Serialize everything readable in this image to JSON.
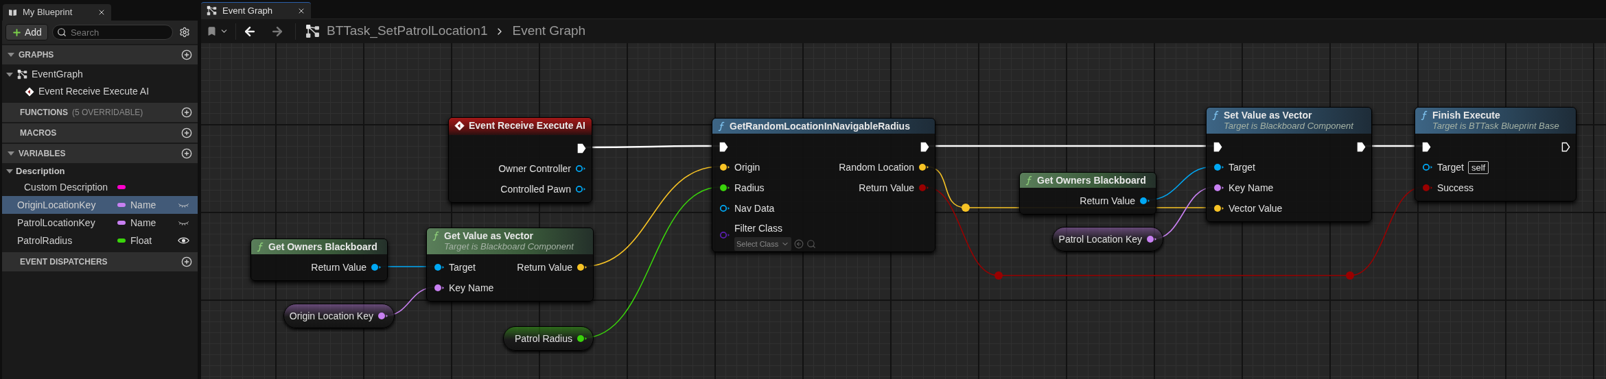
{
  "left_panel": {
    "tab": {
      "title": "My Blueprint"
    },
    "add_button": "Add",
    "search": {
      "placeholder": "Search"
    },
    "sections": [
      {
        "title": "GRAPHS",
        "expanded": true,
        "items": [
          {
            "label": "EventGraph",
            "kind": "graph",
            "expanded": true,
            "children": [
              {
                "label": "Event Receive Execute AI",
                "kind": "event"
              }
            ]
          }
        ]
      },
      {
        "title": "FUNCTIONS",
        "note": "(5 OVERRIDABLE)",
        "expanded": false
      },
      {
        "title": "MACROS",
        "expanded": false
      },
      {
        "title": "VARIABLES",
        "expanded": true,
        "variables": [
          {
            "kind": "category",
            "label": "Description",
            "expanded": true,
            "children": [
              {
                "kind": "variable",
                "name": "Custom Description",
                "color": "#ff00cc",
                "selected": false
              }
            ]
          },
          {
            "kind": "variable",
            "name": "OriginLocationKey",
            "type": "Name",
            "color": "#c880f2",
            "selected": true,
            "public": false
          },
          {
            "kind": "variable",
            "name": "PatrolLocationKey",
            "type": "Name",
            "color": "#c880f2",
            "selected": false,
            "public": false
          },
          {
            "kind": "variable",
            "name": "PatrolRadius",
            "type": "Float",
            "color": "#3ad40b",
            "selected": false,
            "public": true
          }
        ]
      },
      {
        "title": "EVENT DISPATCHERS",
        "expanded": false
      }
    ]
  },
  "graph_tab": {
    "title": "Event Graph",
    "selected": true
  },
  "breadcrumb": [
    "BTTask_SetPatrolLocation1",
    "Event Graph"
  ],
  "nodes": [
    {
      "kind": "event",
      "title": "Event Receive Execute AI",
      "outputs": [
        {
          "kind": "exec",
          "connected": true
        },
        {
          "kind": "data",
          "label": "Owner Controller",
          "color": "#00a8f4",
          "connected": false
        },
        {
          "kind": "data",
          "label": "Controlled Pawn",
          "color": "#00a8f4",
          "connected": false
        }
      ]
    },
    {
      "kind": "pure",
      "title": "Get Owners Blackboard",
      "outputs": [
        {
          "kind": "data",
          "label": "Return Value",
          "color": "#00a8f4",
          "connected": true
        }
      ]
    },
    {
      "kind": "pure",
      "title": "Get Value as Vector",
      "subtitle": "Target is Blackboard Component",
      "inputs": [
        {
          "kind": "data",
          "label": "Target",
          "color": "#00a8f4",
          "connected": true
        },
        {
          "kind": "data",
          "label": "Key Name",
          "color": "#c880f2",
          "connected": true
        }
      ],
      "outputs": [
        {
          "kind": "data",
          "label": "Return Value",
          "color": "#f7c325",
          "connected": true
        }
      ]
    },
    {
      "kind": "variable",
      "outputs": [
        {
          "kind": "data",
          "label": "Origin Location Key",
          "color": "#c880f2",
          "connected": true
        }
      ]
    },
    {
      "kind": "variable",
      "outputs": [
        {
          "kind": "data",
          "label": "Patrol Radius",
          "color": "#3ad40b",
          "connected": true
        }
      ]
    },
    {
      "kind": "function",
      "title": "GetRandomLocationInNavigableRadius",
      "inputs": [
        {
          "kind": "exec",
          "connected": true
        },
        {
          "kind": "data",
          "label": "Origin",
          "color": "#f7c325",
          "connected": true
        },
        {
          "kind": "data",
          "label": "Radius",
          "color": "#3ad40b",
          "connected": true
        },
        {
          "kind": "data",
          "label": "Nav Data",
          "color": "#00a8f4",
          "connected": false
        },
        {
          "kind": "class",
          "label": "Filter Class",
          "color": "#5a1fb0",
          "connected": false,
          "select": "Select Class"
        }
      ],
      "outputs": [
        {
          "kind": "exec",
          "connected": true
        },
        {
          "kind": "data",
          "label": "Random Location",
          "color": "#f7c325",
          "connected": true
        },
        {
          "kind": "data",
          "label": "Return Value",
          "color": "#990000",
          "connected": true
        }
      ]
    },
    {
      "kind": "pure",
      "title": "Get Owners Blackboard",
      "outputs": [
        {
          "kind": "data",
          "label": "Return Value",
          "color": "#00a8f4",
          "connected": true
        }
      ]
    },
    {
      "kind": "variable",
      "outputs": [
        {
          "kind": "data",
          "label": "Patrol Location Key",
          "color": "#c880f2",
          "connected": true
        }
      ]
    },
    {
      "kind": "function",
      "title": "Set Value as Vector",
      "subtitle": "Target is Blackboard Component",
      "inputs": [
        {
          "kind": "exec",
          "connected": true
        },
        {
          "kind": "data",
          "label": "Target",
          "color": "#00a8f4",
          "connected": true
        },
        {
          "kind": "data",
          "label": "Key Name",
          "color": "#c880f2",
          "connected": true
        },
        {
          "kind": "data",
          "label": "Vector Value",
          "color": "#f7c325",
          "connected": true
        }
      ],
      "outputs": [
        {
          "kind": "exec",
          "connected": true
        }
      ]
    },
    {
      "kind": "function",
      "title": "Finish Execute",
      "subtitle": "Target is BTTask Blueprint Base",
      "inputs": [
        {
          "kind": "exec",
          "connected": true
        },
        {
          "kind": "data",
          "label": "Target",
          "color": "#00a8f4",
          "connected": false,
          "value": "self"
        },
        {
          "kind": "data",
          "label": "Success",
          "color": "#990000",
          "connected": true
        }
      ],
      "outputs": [
        {
          "kind": "exec",
          "connected": false
        }
      ]
    }
  ]
}
